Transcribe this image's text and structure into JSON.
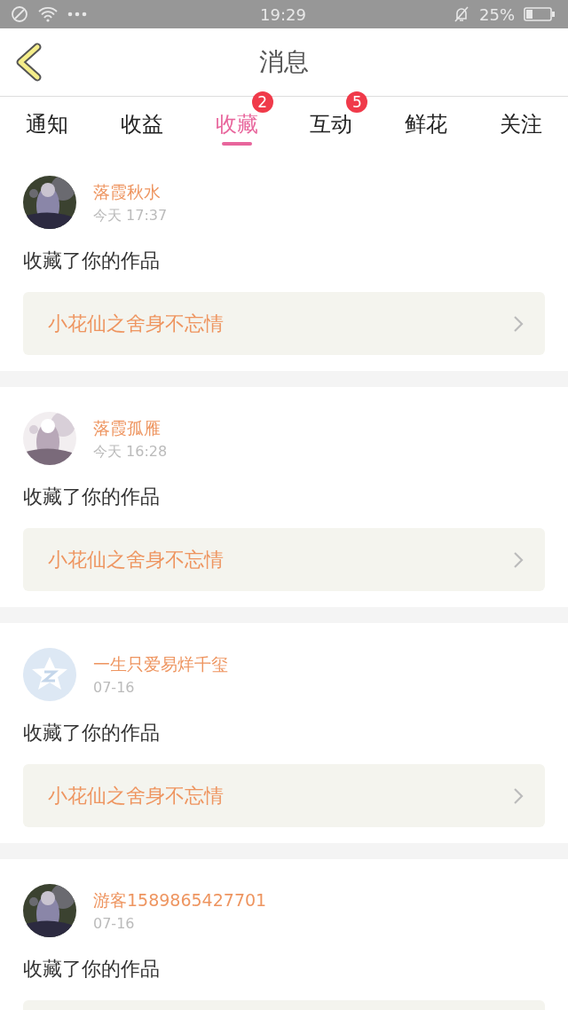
{
  "status_bar": {
    "time": "19:29",
    "battery_text": "25%"
  },
  "header": {
    "title": "消息"
  },
  "tabs": [
    {
      "label": "通知",
      "selected": false
    },
    {
      "label": "收益",
      "selected": false
    },
    {
      "label": "收藏",
      "selected": true,
      "badge": "2"
    },
    {
      "label": "互动",
      "selected": false,
      "badge": "5"
    },
    {
      "label": "鲜花",
      "selected": false
    },
    {
      "label": "关注",
      "selected": false
    }
  ],
  "items": [
    {
      "kind": "picture",
      "name": "落霞秋水",
      "time": "今天 17:37",
      "action": "收藏了你的作品",
      "work": "小花仙之舍身不忘情"
    },
    {
      "kind": "picture",
      "name": "落霞孤雁",
      "time": "今天 16:28",
      "action": "收藏了你的作品",
      "work": "小花仙之舍身不忘情"
    },
    {
      "kind": "default",
      "name": "一生只爱易烊千玺",
      "time": "07-16",
      "action": "收藏了你的作品",
      "work": "小花仙之舍身不忘情"
    },
    {
      "kind": "picture",
      "name": "游客1589865427701",
      "time": "07-16",
      "action": "收藏了你的作品"
    }
  ]
}
